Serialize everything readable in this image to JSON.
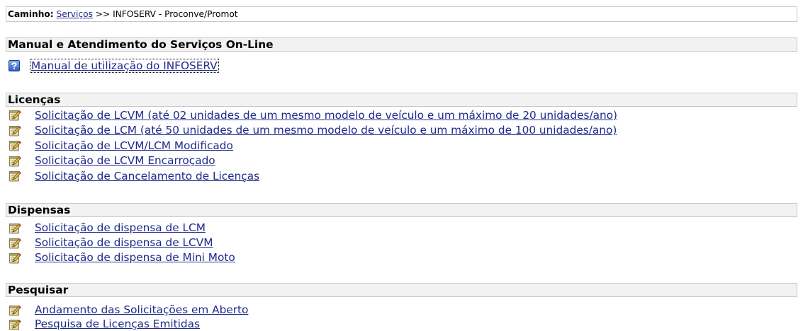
{
  "breadcrumb": {
    "label": "Caminho:",
    "link": "Serviços",
    "separator": ">>",
    "current": "INFOSERV - Proconve/Promot"
  },
  "sections": [
    {
      "title": "Manual e Atendimento do Serviços On-Line",
      "icon": "help-icon",
      "items": [
        {
          "label": "Manual de utilização do INFOSERV"
        }
      ]
    },
    {
      "title": "Licenças",
      "icon": "edit-note-icon",
      "items": [
        {
          "label": "Solicitação de LCVM (até 02 unidades de um mesmo modelo de veículo e um máximo de 20 unidades/ano)"
        },
        {
          "label": "Solicitação de LCM (até 50 unidades de um mesmo modelo de veículo e um máximo de 100 unidades/ano)"
        },
        {
          "label": "Solicitação de LCVM/LCM Modificado"
        },
        {
          "label": "Solicitação de LCVM Encarroçado"
        },
        {
          "label": "Solicitação de Cancelamento de Licenças"
        }
      ]
    },
    {
      "title": "Dispensas",
      "icon": "edit-note-icon",
      "items": [
        {
          "label": "Solicitação de dispensa de LCM"
        },
        {
          "label": "Solicitação de dispensa de LCVM"
        },
        {
          "label": "Solicitação de dispensa de Mini Moto"
        }
      ]
    },
    {
      "title": "Pesquisar",
      "icon": "edit-note-icon",
      "items": [
        {
          "label": "Andamento das Solicitações em Aberto"
        },
        {
          "label": "Pesquisa de Licenças Emitidas"
        }
      ]
    }
  ],
  "colors": {
    "link": "#1f2a8a",
    "header_bg": "#f2f2f2",
    "border": "#c8c8c8",
    "text": "#000000"
  }
}
